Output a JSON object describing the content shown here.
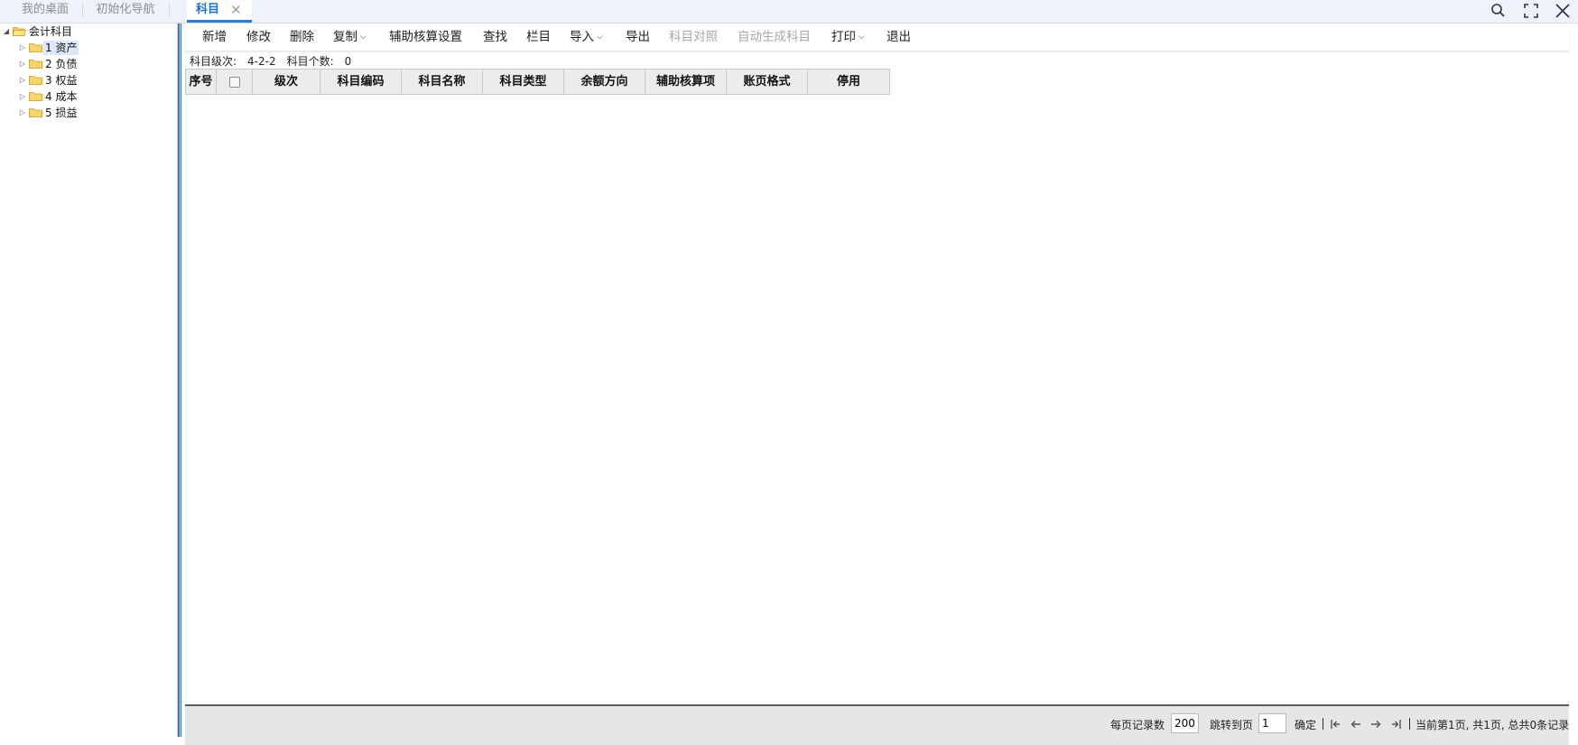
{
  "tabs": {
    "desktop": "我的桌面",
    "init_nav": "初始化导航",
    "active": "科目",
    "close_glyph": "✕"
  },
  "window_controls": [
    "search-icon",
    "fullscreen-icon",
    "close-icon"
  ],
  "tree": {
    "root": "会计科目",
    "children": [
      "1 资产",
      "2 负债",
      "3 权益",
      "4 成本",
      "5 损益"
    ],
    "selected_index": 0
  },
  "toolbar": {
    "add": "新增",
    "edit": "修改",
    "delete": "删除",
    "copy": "复制",
    "aux_settings": "辅助核算设置",
    "find": "查找",
    "columns": "栏目",
    "import": "导入",
    "export": "导出",
    "subject_compare": "科目对照",
    "auto_generate": "自动生成科目",
    "print": "打印",
    "exit": "退出"
  },
  "info": {
    "level_label": "科目级次:",
    "level_value": "4-2-2",
    "count_label": "科目个数:",
    "count_value": "0"
  },
  "grid": {
    "columns": [
      "序号",
      "",
      "级次",
      "科目编码",
      "科目名称",
      "科目类型",
      "余额方向",
      "辅助核算项",
      "账页格式",
      "停用"
    ]
  },
  "pager": {
    "per_page_label": "每页记录数",
    "per_page_value": "200",
    "jump_label": "跳转到页",
    "jump_value": "1",
    "confirm": "确定",
    "status": "当前第1页, 共1页, 总共0条记录"
  },
  "colors": {
    "accent": "#1e73d8",
    "tab_bar": "#eef2fa",
    "header_bg": "#ececec",
    "pager_bg": "#e6e6e6"
  }
}
